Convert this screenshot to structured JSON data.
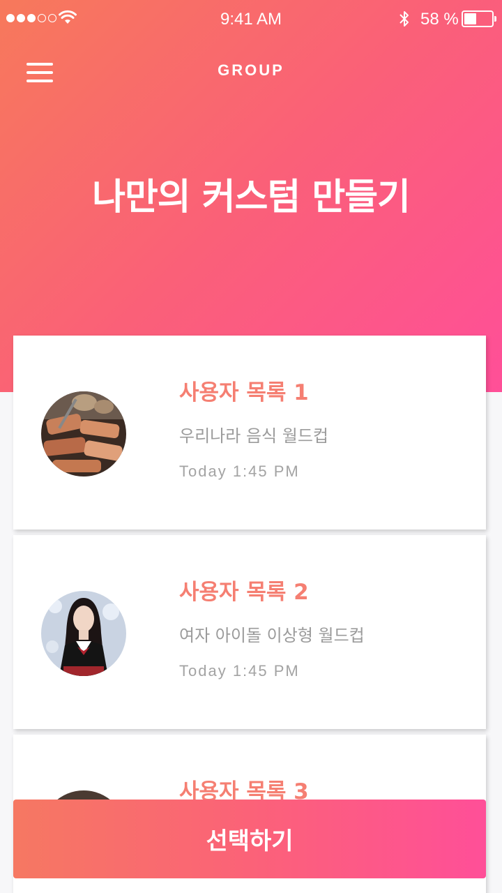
{
  "status_bar": {
    "time": "9:41 AM",
    "battery_percent": "58 %",
    "battery_level": 0.45,
    "signal_bars": 3,
    "icons": [
      "signal-dots-icon",
      "wifi-icon",
      "bluetooth-icon",
      "battery-icon"
    ]
  },
  "nav": {
    "title": "GROUP",
    "menu_icon": "hamburger-menu-icon"
  },
  "hero": {
    "title": "나만의 커스텀 만들기"
  },
  "lists": [
    {
      "title": "사용자 목록 1",
      "subtitle": "우리나라 음식 월드컵",
      "time": "Today 1:45 PM"
    },
    {
      "title": "사용자 목록 2",
      "subtitle": "여자 아이돌 이상형 월드컵",
      "time": "Today 1:45 PM"
    },
    {
      "title": "사용자 목록 3",
      "subtitle": "",
      "time": ""
    }
  ],
  "action": {
    "select_label": "선택하기"
  },
  "colors": {
    "gradient_start": "#f7795b",
    "gradient_end": "#ff4f98",
    "card_title": "#f57f72",
    "muted_text": "#9b9b9b"
  }
}
